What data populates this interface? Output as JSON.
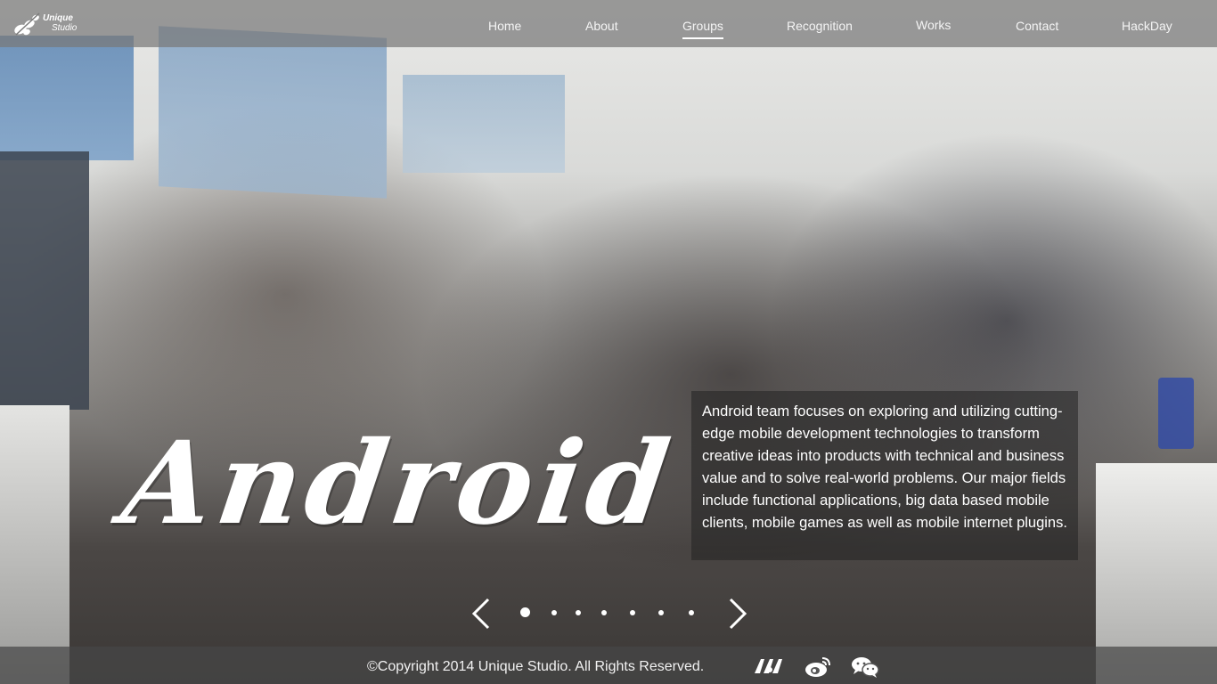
{
  "brand": {
    "line1": "Unique",
    "line2": "Studio",
    "logo_icon": "unique-studio-logo"
  },
  "nav": {
    "items": [
      {
        "label": "Home"
      },
      {
        "label": "About"
      },
      {
        "label": "Groups"
      },
      {
        "label": "Recognition"
      },
      {
        "label": "Works"
      },
      {
        "label": "Contact"
      },
      {
        "label": "HackDay"
      }
    ],
    "active": "Groups"
  },
  "hero": {
    "title": "Android",
    "description": "Android team focuses on exploring and utilizing cut­ting-edge mobile development technologies to trans­form creative ideas into products with technical and business value and to solve real-world problems. Our major fields include functional applications, big data based mobile clients, mobile games as well as mobile internet plugins."
  },
  "carousel": {
    "prev_icon": "chevron-left-icon",
    "next_icon": "chevron-right-icon",
    "slide_count": 7,
    "active_index": 1
  },
  "footer": {
    "copyright": "©Copyright 2014 Unique Studio. All Rights Reserved.",
    "social_icons": [
      "unique-studio-icon",
      "weibo-icon",
      "wechat-icon"
    ]
  },
  "colors": {
    "nav_bg": "#787878",
    "text": "#ffffff",
    "panel_bg": "#232323"
  }
}
